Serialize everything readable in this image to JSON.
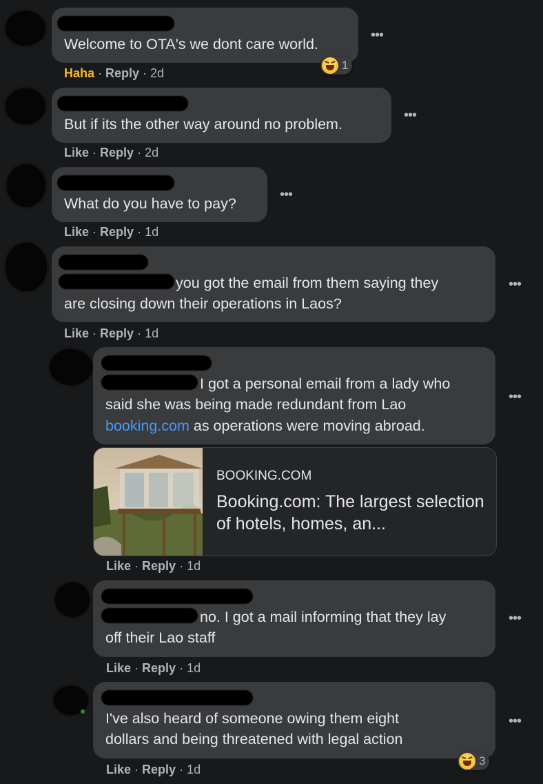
{
  "comments": [
    {
      "text_lines": [
        "Welcome to OTA's we dont care world."
      ],
      "actions": {
        "reaction": "Haha",
        "reply": "Reply",
        "time": "2d"
      },
      "reaction_count": "1"
    },
    {
      "text_lines": [
        "But if its the other way around no problem."
      ],
      "actions": {
        "like": "Like",
        "reply": "Reply",
        "time": "2d"
      }
    },
    {
      "text_lines": [
        "What do you have to pay?"
      ],
      "actions": {
        "like": "Like",
        "reply": "Reply",
        "time": "1d"
      }
    },
    {
      "text_lines": [
        "you got the email from them saying they",
        "are closing down their operations in Laos?"
      ],
      "actions": {
        "like": "Like",
        "reply": "Reply",
        "time": "1d"
      }
    }
  ],
  "replies": [
    {
      "line1": "I got a personal email from a lady who",
      "line2": "said she was being made redundant from Lao",
      "link": "booking.com",
      "line3_rest": " as operations were moving abroad.",
      "link_preview": {
        "domain": "BOOKING.COM",
        "title": "Booking.com: The largest selection of hotels, homes, an..."
      },
      "actions": {
        "like": "Like",
        "reply": "Reply",
        "time": "1d"
      }
    },
    {
      "text_lines": [
        "no. I got a mail informing that they lay",
        "off their Lao staff"
      ],
      "actions": {
        "like": "Like",
        "reply": "Reply",
        "time": "1d"
      }
    },
    {
      "text_lines": [
        "I've also heard of someone owing them eight",
        "dollars and being threatened with legal action"
      ],
      "actions": {
        "like": "Like",
        "reply": "Reply",
        "time": "1d"
      },
      "reaction_count": "3"
    }
  ],
  "icons": {
    "more": "more-options-icon",
    "reaction": "haha-emoji-icon"
  },
  "colors": {
    "background": "#18191a",
    "bubble": "#3a3b3c",
    "link": "#4599ff",
    "haha": "#f7b928"
  }
}
